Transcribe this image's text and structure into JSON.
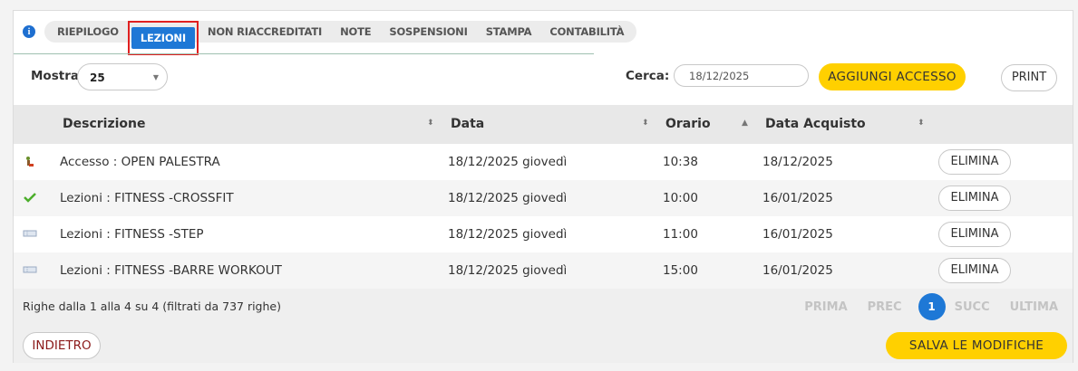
{
  "tabs": [
    {
      "label": "RIEPILOGO"
    },
    {
      "label": "LEZIONI",
      "active": true
    },
    {
      "label": "NON RIACCREDITATI"
    },
    {
      "label": "NOTE"
    },
    {
      "label": "SOSPENSIONI"
    },
    {
      "label": "STAMPA"
    },
    {
      "label": "CONTABILITÀ"
    }
  ],
  "toolbar": {
    "show_label": "Mostra",
    "show_value": "25",
    "search_label": "Cerca:",
    "search_value": "18/12/2025",
    "add_button": "AGGIUNGI ACCESSO",
    "print_button": "PRINT"
  },
  "table": {
    "columns": [
      "Descrizione",
      "Data",
      "Orario",
      "Data Acquisto"
    ],
    "rows": [
      {
        "icon": "person-walking-icon",
        "description": "Accesso : OPEN PALESTRA",
        "date": "18/12/2025 giovedì",
        "time": "10:38",
        "purchase_date": "18/12/2025",
        "action": "ELIMINA"
      },
      {
        "icon": "checkmark-icon",
        "description": "Lezioni : FITNESS -CROSSFIT",
        "date": "18/12/2025 giovedì",
        "time": "10:00",
        "purchase_date": "16/01/2025",
        "action": "ELIMINA"
      },
      {
        "icon": "ticket-icon",
        "description": "Lezioni : FITNESS -STEP",
        "date": "18/12/2025 giovedì",
        "time": "11:00",
        "purchase_date": "16/01/2025",
        "action": "ELIMINA"
      },
      {
        "icon": "ticket-icon",
        "description": "Lezioni : FITNESS -BARRE WORKOUT",
        "date": "18/12/2025 giovedì",
        "time": "15:00",
        "purchase_date": "16/01/2025",
        "action": "ELIMINA"
      }
    ]
  },
  "footer": {
    "summary": "Righe dalla 1 alla 4 su 4 (filtrati da 737 righe)",
    "pager": {
      "first": "PRIMA",
      "prev": "PREC",
      "current": "1",
      "next": "SUCC",
      "last": "ULTIMA"
    },
    "back_button": "INDIETRO",
    "save_button": "SALVA LE MODIFICHE"
  },
  "colors": {
    "accent_blue": "#1e78d6",
    "yellow": "#ffd000",
    "highlight_red": "#e02020"
  }
}
